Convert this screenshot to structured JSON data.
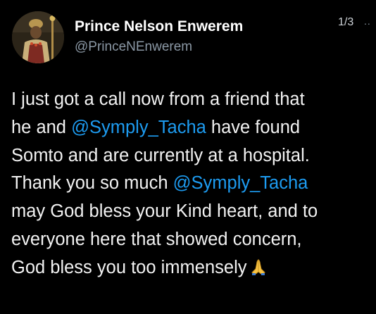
{
  "tweet": {
    "author_name": "Prince Nelson Enwerem",
    "author_handle": "@PrinceNEnwerem",
    "thread_counter": "1/3",
    "more_icon": "more-dots-icon",
    "avatar_icon": "avatar",
    "lines": [
      [
        "I just got a call now from a friend that"
      ],
      [
        "he and ",
        "@Symply_Tacha",
        " have found"
      ],
      [
        "Somto and are currently at a hospital."
      ],
      [
        "Thank you so much ",
        "@Symply_Tacha"
      ],
      [
        "may God bless your Kind heart, and to"
      ],
      [
        "everyone here that showed concern,"
      ],
      [
        "God bless you too immensely"
      ]
    ],
    "trailing_icon": "praying-hands-icon"
  },
  "colors": {
    "background": "#000000",
    "text": "#f2f2f2",
    "handle": "#8b98a5",
    "mention": "#1d9bf0"
  }
}
